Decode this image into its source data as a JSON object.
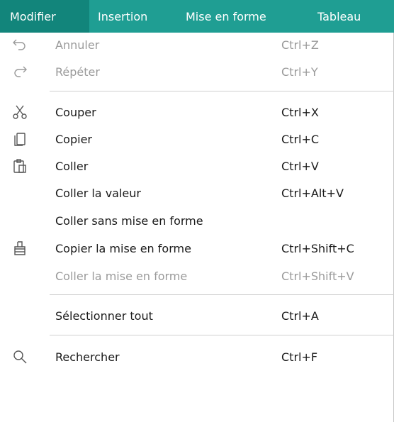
{
  "menubar": {
    "items": [
      "Modifier",
      "Insertion",
      "Mise en forme",
      "Tableau"
    ],
    "active_color": "#12857b",
    "bar_color": "#1f9e93"
  },
  "menu": {
    "items": [
      {
        "label": "Annuler",
        "shortcut": "Ctrl+Z",
        "icon": "undo-icon",
        "disabled": true
      },
      {
        "label": "Répéter",
        "shortcut": "Ctrl+Y",
        "icon": "redo-icon",
        "disabled": true
      },
      {
        "label": "Couper",
        "shortcut": "Ctrl+X",
        "icon": "scissors-icon",
        "disabled": false
      },
      {
        "label": "Copier",
        "shortcut": "Ctrl+C",
        "icon": "copy-icon",
        "disabled": false
      },
      {
        "label": "Coller",
        "shortcut": "Ctrl+V",
        "icon": "paste-icon",
        "disabled": false
      },
      {
        "label": "Coller la valeur",
        "shortcut": "Ctrl+Alt+V",
        "icon": "",
        "disabled": false
      },
      {
        "label": "Coller sans mise en forme",
        "shortcut": "",
        "icon": "",
        "disabled": false
      },
      {
        "label": "Copier la mise en forme",
        "shortcut": "Ctrl+Shift+C",
        "icon": "format-painter-icon",
        "disabled": false
      },
      {
        "label": "Coller la mise en forme",
        "shortcut": "Ctrl+Shift+V",
        "icon": "",
        "disabled": true
      },
      {
        "label": "Sélectionner tout",
        "shortcut": "Ctrl+A",
        "icon": "",
        "disabled": false
      },
      {
        "label": "Rechercher",
        "shortcut": "Ctrl+F",
        "icon": "search-icon",
        "disabled": false
      }
    ]
  }
}
